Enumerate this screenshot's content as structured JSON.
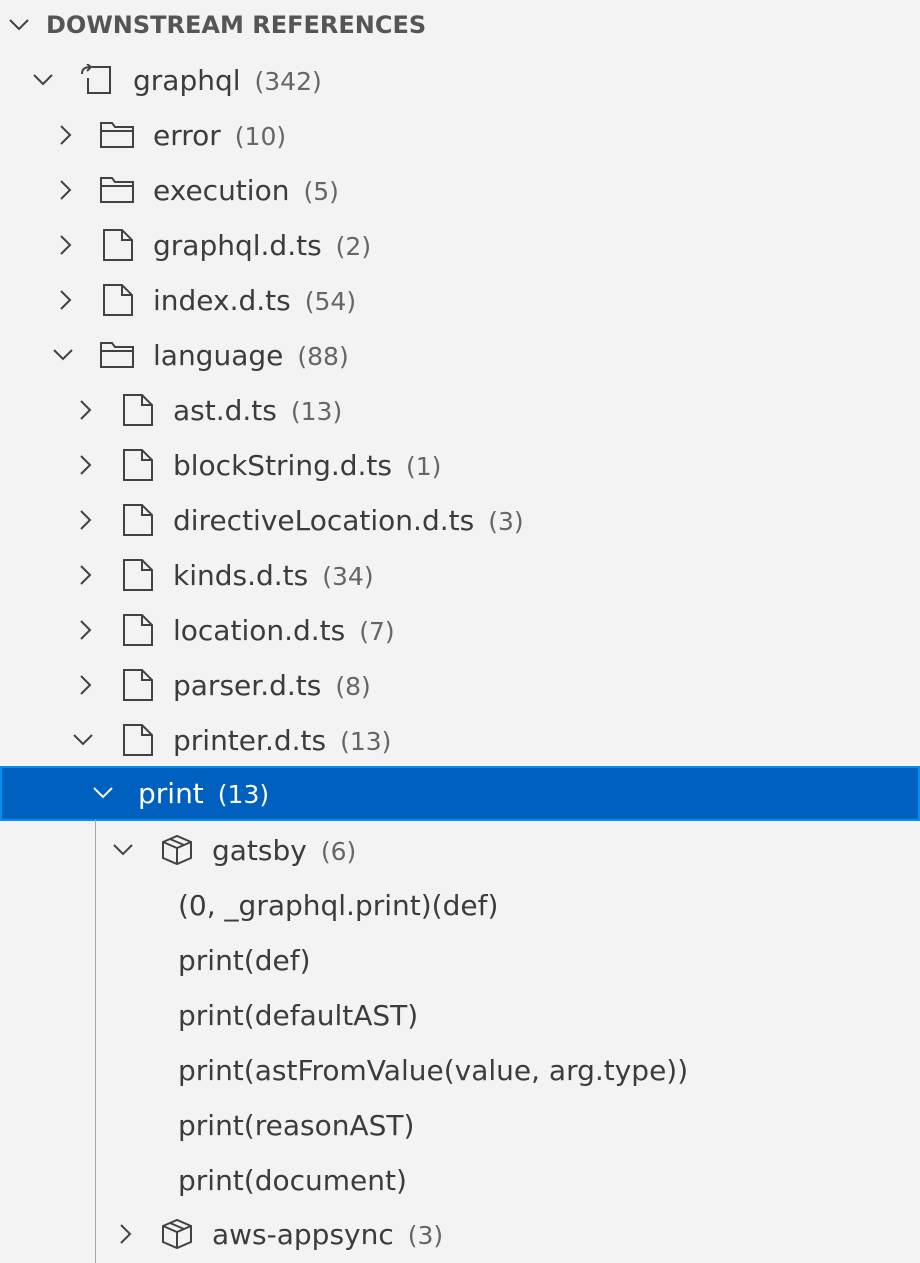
{
  "panel": {
    "title": "DOWNSTREAM REFERENCES"
  },
  "tree": {
    "graphql": {
      "label": "graphql",
      "count": "(342)"
    },
    "error": {
      "label": "error",
      "count": "(10)"
    },
    "execution": {
      "label": "execution",
      "count": "(5)"
    },
    "graphql_dts": {
      "label": "graphql.d.ts",
      "count": "(2)"
    },
    "index_dts": {
      "label": "index.d.ts",
      "count": "(54)"
    },
    "language": {
      "label": "language",
      "count": "(88)"
    },
    "ast_dts": {
      "label": "ast.d.ts",
      "count": "(13)"
    },
    "blockstring_dts": {
      "label": "blockString.d.ts",
      "count": "(1)"
    },
    "directivelocation_dts": {
      "label": "directiveLocation.d.ts",
      "count": "(3)"
    },
    "kinds_dts": {
      "label": "kinds.d.ts",
      "count": "(34)"
    },
    "location_dts": {
      "label": "location.d.ts",
      "count": "(7)"
    },
    "parser_dts": {
      "label": "parser.d.ts",
      "count": "(8)"
    },
    "printer_dts": {
      "label": "printer.d.ts",
      "count": "(13)"
    },
    "print": {
      "label": "print",
      "count": "(13)"
    },
    "gatsby": {
      "label": "gatsby",
      "count": "(6)"
    },
    "references": [
      "(0, _graphql.print)(def)",
      "print(def)",
      "print(defaultAST)",
      "print(astFromValue(value, arg.type))",
      "print(reasonAST)",
      "print(document)"
    ],
    "aws_appsync": {
      "label": "aws-appsync",
      "count": "(3)"
    }
  },
  "colors": {
    "background": "#f3f3f3",
    "selection": "#0060c0",
    "selection_border": "#0090f1",
    "text": "#3c3c3c",
    "icon": "#424242"
  },
  "icons": {
    "expanded": "chevron-down-icon",
    "collapsed": "chevron-right-icon",
    "folder": "folder-icon",
    "file": "file-icon",
    "package": "package-icon",
    "root": "references-root-icon"
  }
}
